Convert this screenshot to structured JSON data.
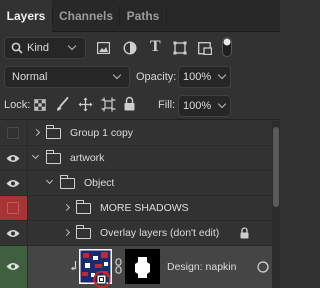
{
  "tabs": [
    {
      "label": "Layers",
      "active": true
    },
    {
      "label": "Channels",
      "active": false
    },
    {
      "label": "Paths",
      "active": false
    }
  ],
  "filter": {
    "kind_label": "Kind",
    "icons": [
      "image-filter-icon",
      "adjustment-filter-icon",
      "type-filter-icon",
      "shape-filter-icon",
      "smart-object-filter-icon",
      "filter-toggle-icon"
    ]
  },
  "blend": {
    "mode": "Normal",
    "opacity_label": "Opacity:",
    "opacity_value": "100%"
  },
  "lock": {
    "label": "Lock:",
    "icons": [
      "lock-transparent-icon",
      "lock-image-icon",
      "lock-position-icon",
      "lock-artboard-icon",
      "lock-all-icon"
    ],
    "fill_label": "Fill:",
    "fill_value": "100%"
  },
  "layers": [
    {
      "name": "Group 1 copy",
      "visible": false,
      "type": "group",
      "depth": 0,
      "expanded": false,
      "swatch": "#323232"
    },
    {
      "name": "artwork",
      "visible": true,
      "type": "group",
      "depth": 0,
      "expanded": true,
      "swatch": "#323232"
    },
    {
      "name": "Object",
      "visible": true,
      "type": "group",
      "depth": 1,
      "expanded": true,
      "swatch": "#323232"
    },
    {
      "name": "MORE SHADOWS",
      "visible": false,
      "type": "group",
      "depth": 2,
      "expanded": false,
      "swatch": "#a63434"
    },
    {
      "name": "Overlay layers (don't edit)",
      "visible": true,
      "type": "group",
      "depth": 2,
      "expanded": false,
      "locked": true,
      "swatch": "#323232"
    },
    {
      "name": "Design: napkin",
      "visible": true,
      "type": "smart-object",
      "depth": 2,
      "swatch": "#3f5f3f",
      "selected": true
    }
  ],
  "colors": {
    "panel_bg": "#323232",
    "selected_row": "#454545",
    "red_label": "#a63434",
    "green_label": "#3f5f3f",
    "highlight_circle": "#e02020"
  }
}
